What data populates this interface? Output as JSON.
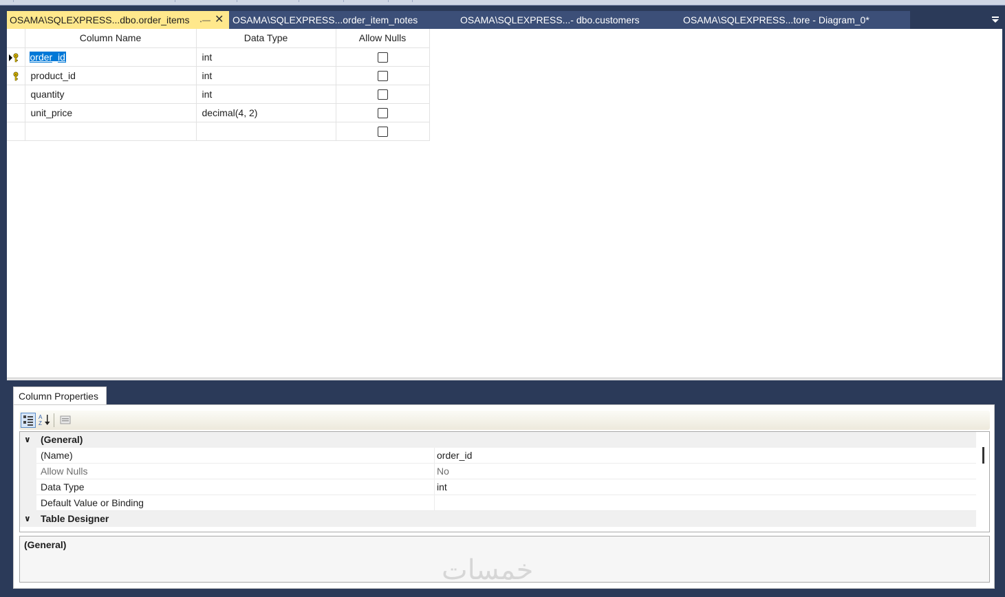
{
  "tabs": [
    {
      "label": "OSAMA\\SQLEXPRESS...dbo.order_items",
      "active": true
    },
    {
      "label": "OSAMA\\SQLEXPRESS...order_item_notes",
      "active": false
    },
    {
      "label": "OSAMA\\SQLEXPRESS...- dbo.customers",
      "active": false
    },
    {
      "label": "OSAMA\\SQLEXPRESS...tore - Diagram_0*",
      "active": false
    }
  ],
  "grid": {
    "headers": {
      "column_name": "Column Name",
      "data_type": "Data Type",
      "allow_nulls": "Allow Nulls"
    },
    "rows": [
      {
        "name": "order_id",
        "type": "int",
        "allow_nulls": false,
        "primary_key": true,
        "current": true
      },
      {
        "name": "product_id",
        "type": "int",
        "allow_nulls": false,
        "primary_key": true,
        "current": false
      },
      {
        "name": "quantity",
        "type": "int",
        "allow_nulls": false,
        "primary_key": false,
        "current": false
      },
      {
        "name": "unit_price",
        "type": "decimal(4, 2)",
        "allow_nulls": false,
        "primary_key": false,
        "current": false
      },
      {
        "name": "",
        "type": "",
        "allow_nulls": false,
        "primary_key": false,
        "current": false
      }
    ]
  },
  "properties": {
    "tab_label": "Column Properties",
    "categories": [
      {
        "name": "(General)",
        "items": [
          {
            "name": "(Name)",
            "value": "order_id",
            "disabled": false
          },
          {
            "name": "Allow Nulls",
            "value": "No",
            "disabled": true
          },
          {
            "name": "Data Type",
            "value": "int",
            "disabled": false
          },
          {
            "name": "Default Value or Binding",
            "value": "",
            "disabled": false
          }
        ]
      },
      {
        "name": "Table Designer",
        "items": []
      }
    ],
    "description_title": "(General)"
  },
  "watermark": "خمسات",
  "colors": {
    "active_tab": "#ffe88c",
    "tab_strip": "#3c4f78",
    "selection": "#0078d7"
  }
}
